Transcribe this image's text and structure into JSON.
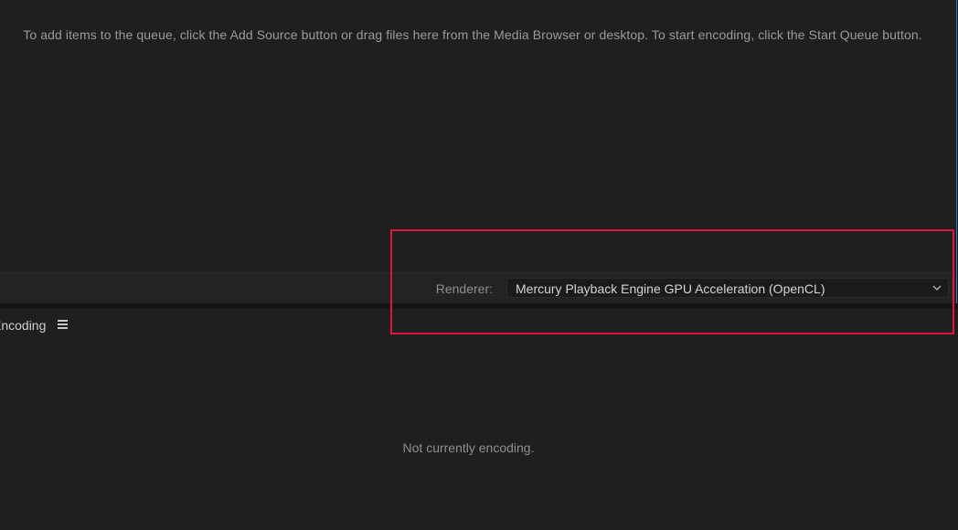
{
  "queue": {
    "hint_text": "To add items to the queue, click the Add Source button or drag files here from the Media Browser or desktop.  To start encoding, click the Start Queue button."
  },
  "renderer": {
    "label": "Renderer:",
    "selected_value": "Mercury Playback Engine GPU Acceleration (OpenCL)",
    "dropdown_icon": "chevron-down-icon"
  },
  "encoding": {
    "tab_title": "Encoding",
    "menu_icon": "hamburger-menu-icon",
    "status_text": "Not currently encoding."
  },
  "colors": {
    "background": "#1e1e1e",
    "panel_border_accent": "#2f6fb0",
    "highlight": "#e0143c"
  }
}
